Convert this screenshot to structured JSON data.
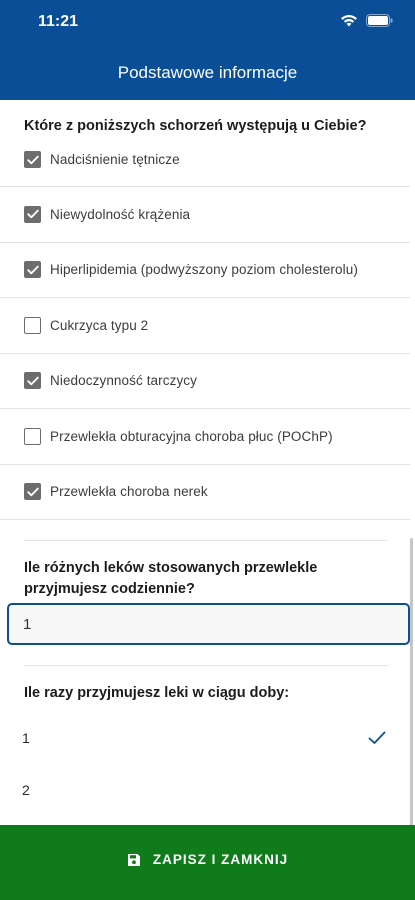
{
  "status_bar": {
    "time": "11:21"
  },
  "navbar": {
    "title": "Podstawowe informacje"
  },
  "conditions": {
    "question": "Które z poniższych schorzeń występują u Ciebie?",
    "items": [
      {
        "label": "Nadciśnienie tętnicze",
        "checked": true
      },
      {
        "label": "Niewydolność krążenia",
        "checked": true
      },
      {
        "label": "Hiperlipidemia (podwyższony poziom cholesterolu)",
        "checked": true
      },
      {
        "label": "Cukrzyca typu 2",
        "checked": false
      },
      {
        "label": "Niedoczynność tarczycy",
        "checked": true
      },
      {
        "label": "Przewlekła obturacyjna choroba płuc (POChP)",
        "checked": false
      },
      {
        "label": "Przewlekła choroba nerek",
        "checked": true
      }
    ]
  },
  "medications": {
    "question": "Ile różnych leków stosowanych przewlekle przyjmujesz codziennie?",
    "value": "1"
  },
  "doses": {
    "question": "Ile razy przyjmujesz leki w ciągu doby:",
    "options": [
      {
        "label": "1",
        "selected": true
      },
      {
        "label": "2",
        "selected": false
      }
    ]
  },
  "footer": {
    "save_label": "ZAPISZ I ZAMKNIJ"
  },
  "colors": {
    "header": "#0a4e97",
    "save": "#0f7b1b",
    "checkbox": "#6d6d6d"
  }
}
